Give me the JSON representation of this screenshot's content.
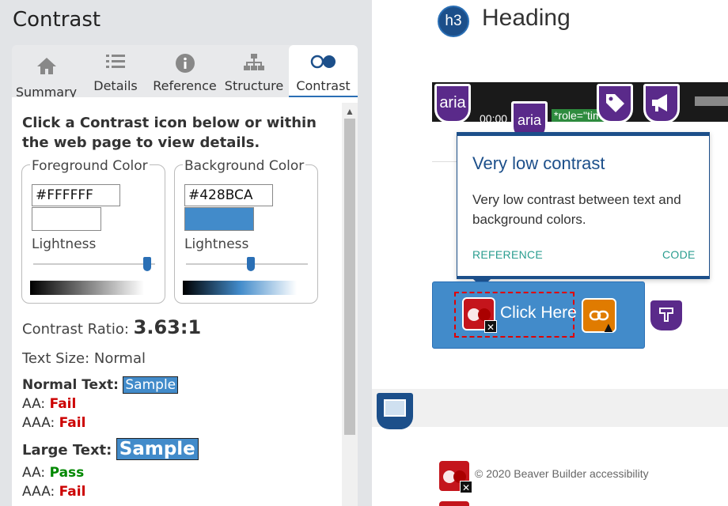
{
  "panel": {
    "title": "Contrast",
    "tabs": [
      {
        "label": "Summary",
        "icon": "home-icon"
      },
      {
        "label": "Details",
        "icon": "list-icon"
      },
      {
        "label": "Reference",
        "icon": "info-icon"
      },
      {
        "label": "Structure",
        "icon": "sitemap-icon"
      },
      {
        "label": "Contrast",
        "icon": "contrast-icon"
      }
    ],
    "active_tab": "Contrast",
    "instructions": "Click a Contrast icon below or within the web page to view details.",
    "foreground": {
      "legend": "Foreground Color",
      "hex": "#FFFFFF",
      "lightness_label": "Lightness",
      "lightness": 0.95
    },
    "background": {
      "legend": "Background Color",
      "hex": "#428BCA",
      "lightness_label": "Lightness",
      "lightness": 0.52
    },
    "ratio_label": "Contrast Ratio:",
    "ratio_value": "3.63:1",
    "text_size_label": "Text Size:",
    "text_size_value": "Normal",
    "normal_text": {
      "label": "Normal Text:",
      "sample": "Sample",
      "aa_label": "AA:",
      "aa": "Fail",
      "aaa_label": "AAA:",
      "aaa": "Fail"
    },
    "large_text": {
      "label": "Large Text:",
      "sample": "Sample",
      "aa_label": "AA:",
      "aa": "Pass",
      "aaa_label": "AAA:",
      "aaa": "Fail"
    }
  },
  "page": {
    "h3_badge": "h3",
    "heading": "Heading",
    "aria_badge_1": "aria",
    "aria_badge_2": "aria",
    "time": "00:00",
    "role_label": "*role=\"tim",
    "tooltip": {
      "title": "Very low contrast",
      "body": "Very low contrast between text and background colors.",
      "reference": "REFERENCE",
      "code": "CODE"
    },
    "button_text": "Click Here",
    "x_badge": "✕",
    "copyright": "© 2020 Beaver Builder accessibility"
  },
  "colors": {
    "accent": "#2a6fb5",
    "sample_bg": "#428bca",
    "fail": "#cc0000",
    "pass": "#008800",
    "error_icon": "#c4151c",
    "aria_purple": "#5a2a8a"
  }
}
